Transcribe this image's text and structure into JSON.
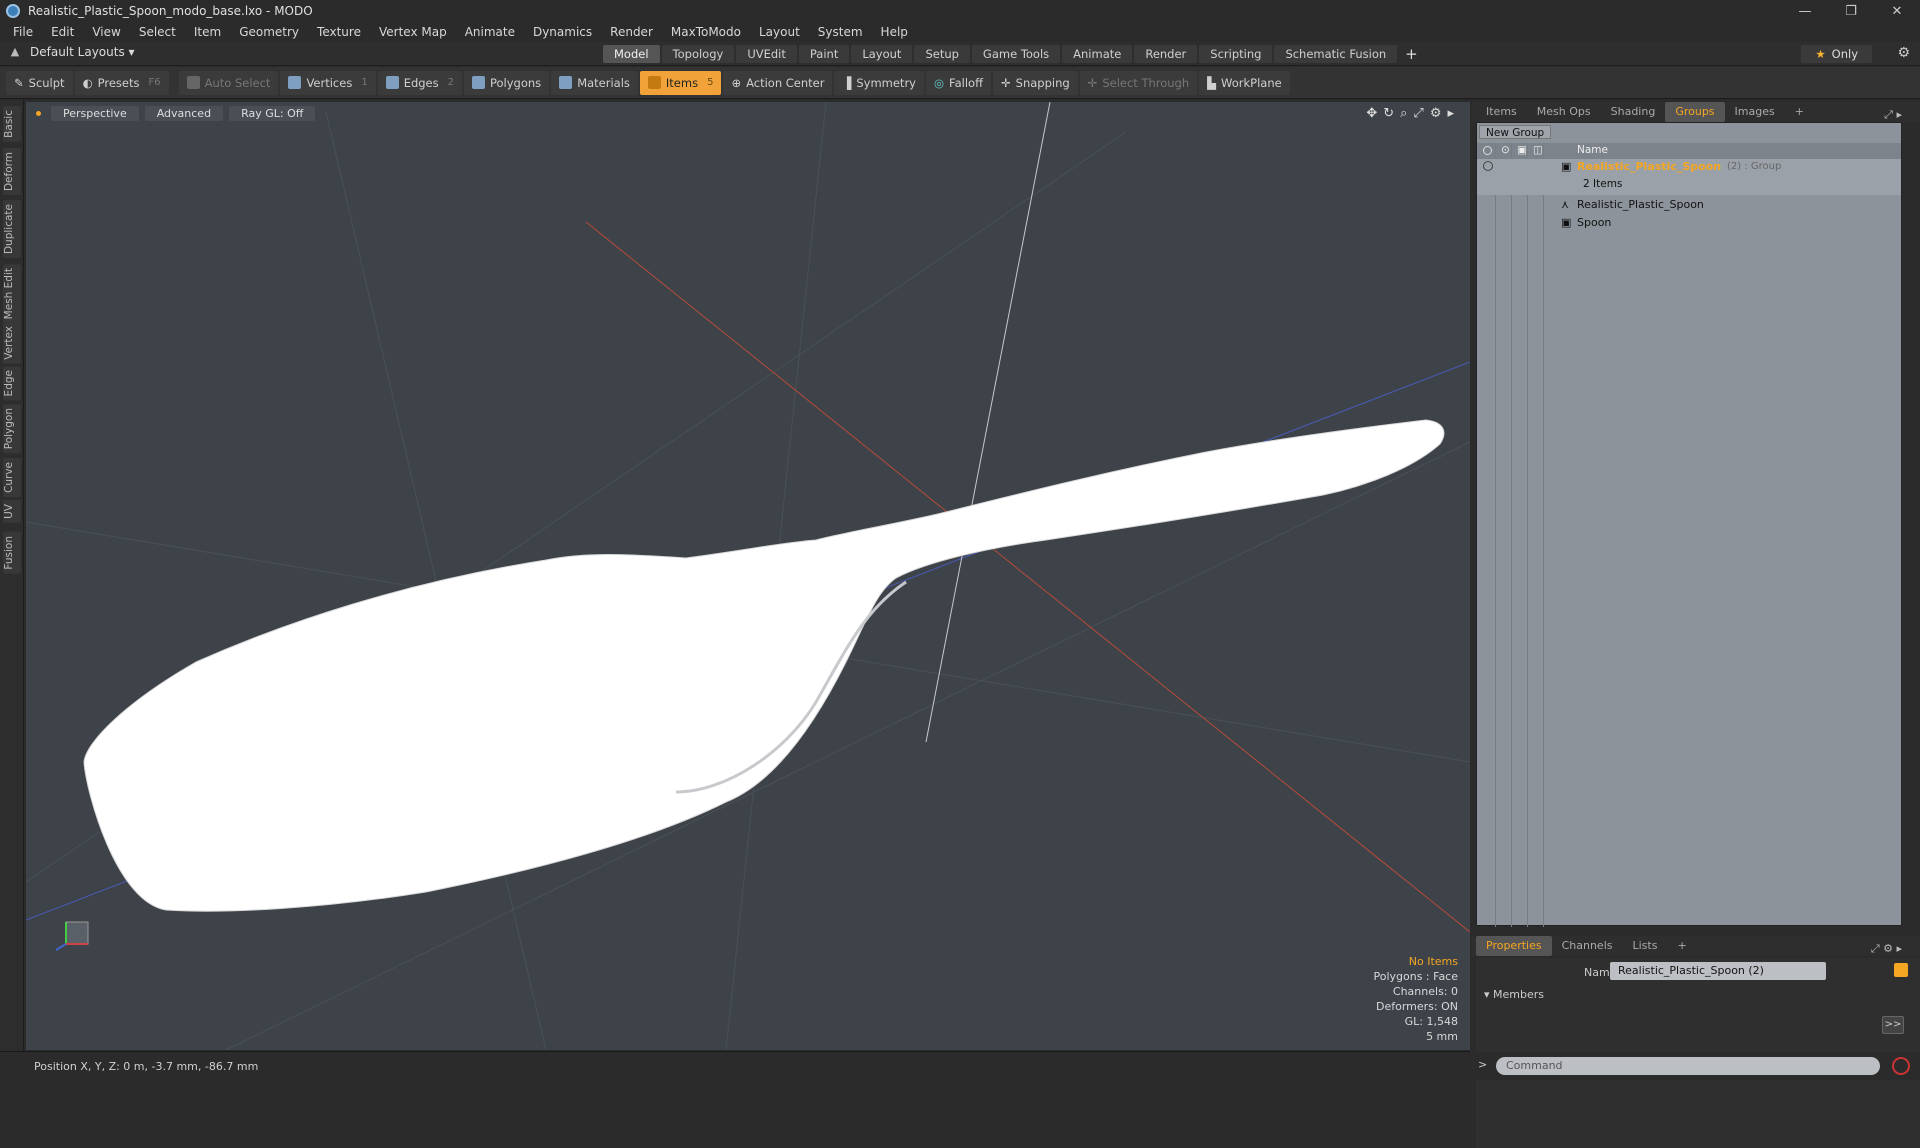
{
  "window": {
    "title": "Realistic_Plastic_Spoon_modo_base.lxo - MODO",
    "controls": [
      "—",
      "❐",
      "✕"
    ]
  },
  "menu": [
    "File",
    "Edit",
    "View",
    "Select",
    "Item",
    "Geometry",
    "Texture",
    "Vertex Map",
    "Animate",
    "Dynamics",
    "Render",
    "MaxToModo",
    "Layout",
    "System",
    "Help"
  ],
  "layoutbar": {
    "layouts_label": "Default Layouts ▾",
    "tabs": [
      "Model",
      "Topology",
      "UVEdit",
      "Paint",
      "Layout",
      "Setup",
      "Game Tools",
      "Animate",
      "Render",
      "Scripting",
      "Schematic Fusion"
    ],
    "active_tab": "Model",
    "add_tab": "+",
    "only_label": "Only"
  },
  "toolbar": {
    "sculpt": "Sculpt",
    "presets": "Presets",
    "presets_key": "F6",
    "auto_select": "Auto Select",
    "vertices": "Vertices",
    "vertices_key": "1",
    "edges": "Edges",
    "edges_key": "2",
    "polygons": "Polygons",
    "materials": "Materials",
    "items": "Items",
    "items_key": "5",
    "action_center": "Action Center",
    "symmetry": "Symmetry",
    "falloff": "Falloff",
    "snapping": "Snapping",
    "select_through": "Select Through",
    "workplane": "WorkPlane"
  },
  "leftstrip": [
    "Basic",
    "Deform",
    "Duplicate",
    "Mesh Edit",
    "Vertex",
    "Edge",
    "Polygon",
    "Curve",
    "UV",
    "Fusion"
  ],
  "viewport": {
    "view_mode": "Perspective",
    "shading": "Advanced",
    "raygl": "Ray GL: Off",
    "info": {
      "items": "No Items",
      "polygons": "Polygons : Face",
      "channels": "Channels: 0",
      "deformers": "Deformers: ON",
      "gl": "GL: 1,548",
      "scale": "5 mm"
    }
  },
  "status": {
    "position": "Position X, Y, Z:  0 m, -3.7 mm, -86.7 mm"
  },
  "right_tabs": {
    "tabs": [
      "Items",
      "Mesh Ops",
      "Shading",
      "Groups",
      "Images"
    ],
    "active": "Groups",
    "add": "+"
  },
  "groups": {
    "new_group": "New Group",
    "name_header": "Name",
    "group_name": "Realistic_Plastic_Spoon",
    "group_suffix": "(2) : Group",
    "group_count": "2 Items",
    "children": [
      "Realistic_Plastic_Spoon",
      "Spoon"
    ]
  },
  "props_tabs": {
    "tabs": [
      "Properties",
      "Channels",
      "Lists"
    ],
    "active": "Properties",
    "add": "+"
  },
  "properties": {
    "name_label": "Name",
    "name_value": "Realistic_Plastic_Spoon (2)",
    "members_label": "Members",
    "add_button": ">>"
  },
  "command": {
    "placeholder": "Command"
  },
  "colors": {
    "accent": "#f5a623",
    "viewport_bg": "#3d4349",
    "panel_bg": "#8d939a"
  }
}
